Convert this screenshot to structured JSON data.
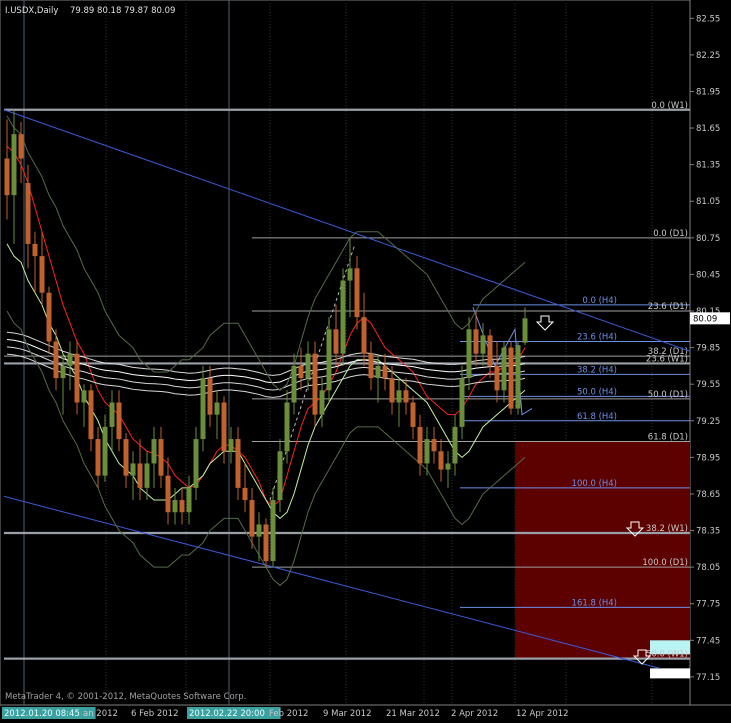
{
  "header": {
    "symbol": "I.USDX,Daily",
    "ohlc": "79.89 80.18 79.87 80.09"
  },
  "footer": {
    "copyright": "MetaTrader 4, © 2001-2012, MetaQuotes Software Corp."
  },
  "price_box": {
    "label": "80.09",
    "value": 80.09
  },
  "colors": {
    "background": "#000000",
    "bull": "#6a8e3a",
    "bear": "#c0622e",
    "ema_red": "#ff2020",
    "bands": "#e8e8e8",
    "trend": "#3a5bd8",
    "fib": "#a0a0a0",
    "fib_h4": "#6d8fe6",
    "zone": "#5c0000",
    "accent_box": "#b8f4f4"
  },
  "chart_data": {
    "type": "candlestick",
    "ylim": [
      77.1,
      82.7
    ],
    "yticks": [
      82.55,
      82.25,
      81.95,
      81.65,
      81.35,
      81.05,
      80.75,
      80.45,
      80.15,
      79.85,
      79.55,
      79.25,
      78.95,
      78.65,
      78.35,
      78.05,
      77.75,
      77.45,
      77.15
    ],
    "xticks": [
      "2012.01.20 08:45",
      "an 2012",
      "6 Feb 2012",
      "2012.02.22 20:00",
      "Feb 2012",
      "9 Mar 2012",
      "21 Mar 2012",
      "2 Apr 2012",
      "12 Apr 2012"
    ],
    "candles": [
      [
        81.4,
        81.72,
        80.9,
        81.1
      ],
      [
        81.1,
        81.8,
        80.7,
        81.6
      ],
      [
        81.6,
        81.7,
        81.2,
        81.4
      ],
      [
        81.2,
        81.35,
        80.5,
        80.7
      ],
      [
        80.7,
        80.8,
        80.3,
        80.6
      ],
      [
        80.6,
        80.8,
        80.2,
        80.3
      ],
      [
        80.3,
        80.35,
        79.8,
        79.9
      ],
      [
        79.9,
        80.0,
        79.5,
        79.6
      ],
      [
        79.6,
        79.8,
        79.3,
        79.7
      ],
      [
        79.7,
        79.9,
        79.5,
        79.8
      ],
      [
        79.8,
        79.9,
        79.3,
        79.4
      ],
      [
        79.4,
        79.55,
        79.2,
        79.5
      ],
      [
        79.5,
        79.55,
        79.0,
        79.1
      ],
      [
        79.1,
        79.2,
        78.7,
        78.8
      ],
      [
        78.8,
        79.3,
        78.75,
        79.2
      ],
      [
        79.2,
        79.5,
        79.0,
        79.4
      ],
      [
        79.4,
        79.5,
        79.0,
        79.1
      ],
      [
        79.1,
        79.15,
        78.7,
        78.8
      ],
      [
        78.8,
        79.0,
        78.6,
        78.9
      ],
      [
        78.9,
        79.1,
        78.6,
        78.7
      ],
      [
        78.7,
        79.0,
        78.6,
        78.9
      ],
      [
        78.9,
        79.2,
        78.7,
        79.1
      ],
      [
        79.1,
        79.2,
        78.7,
        78.8
      ],
      [
        78.8,
        78.95,
        78.4,
        78.5
      ],
      [
        78.5,
        78.7,
        78.4,
        78.6
      ],
      [
        78.6,
        78.7,
        78.4,
        78.5
      ],
      [
        78.5,
        78.8,
        78.4,
        78.7
      ],
      [
        78.7,
        79.2,
        78.6,
        79.1
      ],
      [
        79.1,
        79.7,
        79.0,
        79.6
      ],
      [
        79.6,
        79.7,
        79.2,
        79.3
      ],
      [
        79.3,
        79.5,
        79.1,
        79.4
      ],
      [
        79.4,
        79.45,
        78.9,
        79.0
      ],
      [
        79.0,
        79.2,
        78.9,
        79.1
      ],
      [
        79.1,
        79.2,
        78.6,
        78.7
      ],
      [
        78.7,
        78.9,
        78.5,
        78.6
      ],
      [
        78.6,
        78.7,
        78.2,
        78.3
      ],
      [
        78.3,
        78.5,
        78.1,
        78.4
      ],
      [
        78.4,
        78.45,
        78.05,
        78.1
      ],
      [
        78.1,
        78.7,
        78.05,
        78.6
      ],
      [
        78.6,
        79.1,
        78.5,
        79.0
      ],
      [
        79.0,
        79.5,
        78.9,
        79.4
      ],
      [
        79.4,
        79.8,
        79.3,
        79.7
      ],
      [
        79.7,
        79.85,
        79.5,
        79.6
      ],
      [
        79.6,
        79.9,
        79.5,
        79.8
      ],
      [
        79.8,
        79.9,
        79.2,
        79.3
      ],
      [
        79.3,
        79.6,
        79.2,
        79.5
      ],
      [
        79.5,
        80.1,
        79.4,
        80.0
      ],
      [
        80.0,
        80.2,
        79.7,
        79.8
      ],
      [
        79.8,
        80.5,
        79.7,
        80.4
      ],
      [
        80.4,
        80.75,
        80.1,
        80.5
      ],
      [
        80.5,
        80.6,
        80.0,
        80.1
      ],
      [
        80.1,
        80.3,
        79.7,
        79.8
      ],
      [
        79.8,
        79.9,
        79.5,
        79.6
      ],
      [
        79.6,
        79.8,
        79.4,
        79.7
      ],
      [
        79.7,
        79.8,
        79.5,
        79.6
      ],
      [
        79.6,
        79.7,
        79.3,
        79.4
      ],
      [
        79.4,
        79.6,
        79.2,
        79.5
      ],
      [
        79.5,
        79.6,
        79.3,
        79.4
      ],
      [
        79.4,
        79.45,
        79.1,
        79.2
      ],
      [
        79.2,
        79.3,
        78.8,
        78.9
      ],
      [
        78.9,
        79.2,
        78.8,
        79.1
      ],
      [
        79.1,
        79.2,
        78.9,
        79.0
      ],
      [
        79.0,
        79.1,
        78.75,
        78.85
      ],
      [
        78.85,
        79.0,
        78.7,
        78.9
      ],
      [
        78.9,
        79.3,
        78.8,
        79.2
      ],
      [
        79.2,
        79.7,
        79.1,
        79.6
      ],
      [
        79.6,
        80.1,
        79.5,
        80.0
      ],
      [
        80.0,
        80.15,
        79.7,
        79.8
      ],
      [
        79.8,
        80.05,
        79.7,
        79.95
      ],
      [
        79.95,
        80.0,
        79.6,
        79.7
      ],
      [
        79.7,
        79.9,
        79.4,
        79.5
      ],
      [
        79.5,
        79.9,
        79.4,
        79.85
      ],
      [
        79.85,
        79.9,
        79.3,
        79.35
      ],
      [
        79.35,
        79.9,
        79.3,
        79.87
      ],
      [
        79.89,
        80.18,
        79.87,
        80.09
      ]
    ],
    "indicators": [
      {
        "type": "ema",
        "color": "red",
        "values": [
          81.5,
          81.45,
          81.35,
          81.2,
          81.0,
          80.8,
          80.6,
          80.4,
          80.2,
          80.05,
          79.9,
          79.8,
          79.65,
          79.5,
          79.4,
          79.35,
          79.3,
          79.2,
          79.1,
          79.05,
          79.0,
          78.98,
          78.95,
          78.9,
          78.8,
          78.75,
          78.7,
          78.72,
          78.8,
          78.9,
          79.0,
          79.05,
          79.05,
          79.0,
          78.95,
          78.85,
          78.75,
          78.6,
          78.55,
          78.6,
          78.8,
          79.0,
          79.2,
          79.35,
          79.4,
          79.45,
          79.55,
          79.65,
          79.8,
          79.95,
          80.05,
          80.1,
          80.05,
          79.95,
          79.85,
          79.8,
          79.75,
          79.7,
          79.65,
          79.55,
          79.45,
          79.4,
          79.35,
          79.3,
          79.3,
          79.35,
          79.45,
          79.55,
          79.6,
          79.65,
          79.65,
          79.7,
          79.7,
          79.75,
          79.85
        ]
      },
      {
        "type": "sma",
        "color": "green",
        "values": [
          80.7,
          80.6,
          80.55,
          80.4,
          80.3,
          80.2,
          80.05,
          79.95,
          79.8,
          79.7,
          79.6,
          79.45,
          79.35,
          79.25,
          79.1,
          79.0,
          78.9,
          78.85,
          78.8,
          78.7,
          78.65,
          78.6,
          78.6,
          78.6,
          78.65,
          78.7,
          78.7,
          78.75,
          78.8,
          78.9,
          78.95,
          79.0,
          79.0,
          79.0,
          78.9,
          78.8,
          78.7,
          78.6,
          78.5,
          78.45,
          78.5,
          78.65,
          78.85,
          79.05,
          79.2,
          79.3,
          79.4,
          79.5,
          79.6,
          79.7,
          79.75,
          79.75,
          79.75,
          79.75,
          79.7,
          79.65,
          79.6,
          79.55,
          79.5,
          79.45,
          79.4,
          79.3,
          79.2,
          79.1,
          79.0,
          78.95,
          79.0,
          79.1,
          79.2,
          79.25,
          79.3,
          79.35,
          79.4,
          79.45,
          79.5
        ]
      }
    ],
    "fib_levels": [
      {
        "label": "0.0 (W1)",
        "value": 81.8
      },
      {
        "label": "0.0 (D1)",
        "value": 80.75
      },
      {
        "label": "0.0 (H4)",
        "value": 80.2
      },
      {
        "label": "23.6 (D1)",
        "value": 80.15
      },
      {
        "label": "23.6 (H4)",
        "value": 79.9
      },
      {
        "label": "38.2 (D1)",
        "value": 79.78
      },
      {
        "label": "23.6 (W1)",
        "value": 79.72
      },
      {
        "label": "38.2 (H4)",
        "value": 79.63
      },
      {
        "label": "50.0 (H4)",
        "value": 79.45
      },
      {
        "label": "50.0 (D1)",
        "value": 79.43
      },
      {
        "label": "61.8 (H4)",
        "value": 79.25
      },
      {
        "label": "61.8 (D1)",
        "value": 79.08
      },
      {
        "label": "100.0 (H4)",
        "value": 78.7
      },
      {
        "label": "38.2 (W1)",
        "value": 78.33
      },
      {
        "label": "100.0 (D1)",
        "value": 78.05
      },
      {
        "label": "161.8 (H4)",
        "value": 77.72
      },
      {
        "label": "50.0 (W1)",
        "value": 77.3
      }
    ]
  }
}
